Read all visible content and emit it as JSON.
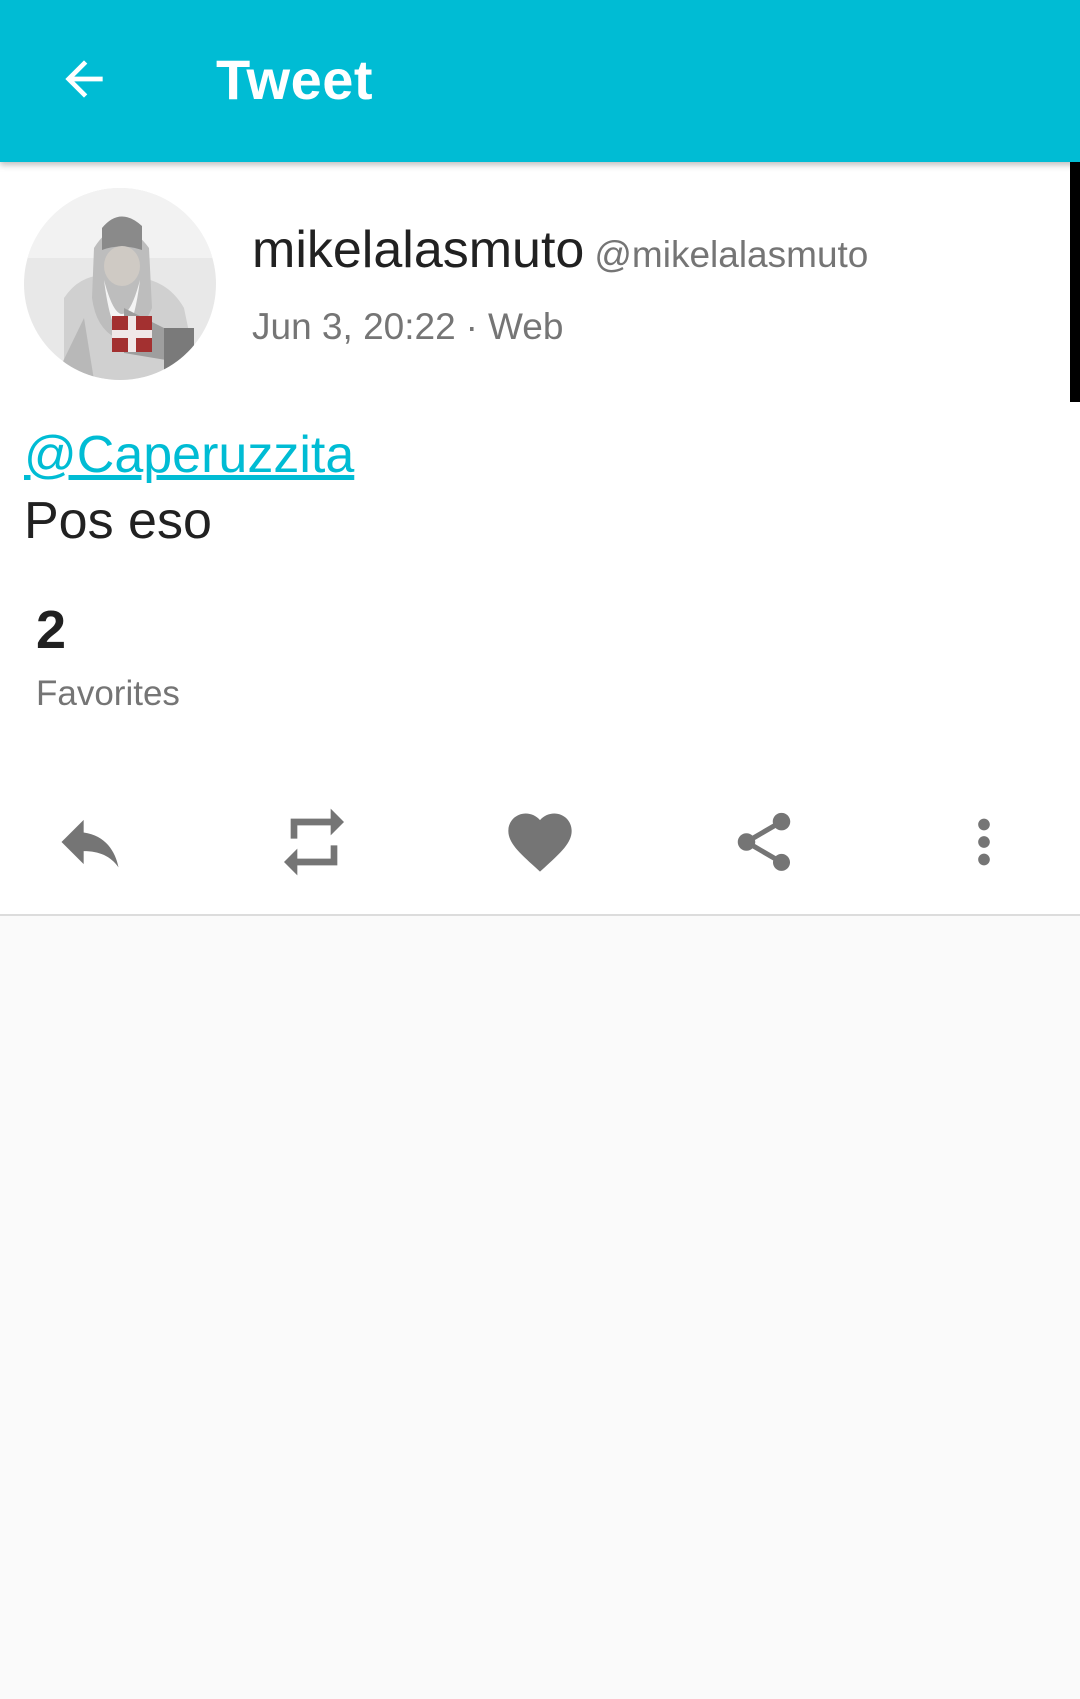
{
  "app_bar": {
    "title": "Tweet",
    "back_icon": "arrow-left-icon",
    "color": "#00bcd4"
  },
  "tweet": {
    "display_name": "mikelalasmuto",
    "handle": "@mikelalasmuto",
    "date": "Jun 3, 20:22",
    "separator": "·",
    "source": "Web",
    "mention": "@Caperuzzita",
    "text": "Pos eso",
    "link_color": "#00bcd4"
  },
  "stats": {
    "favorites_count": "2",
    "favorites_label": "Favorites"
  },
  "actions": [
    {
      "name": "reply",
      "icon": "reply-icon"
    },
    {
      "name": "retweet",
      "icon": "retweet-icon"
    },
    {
      "name": "favorite",
      "icon": "heart-icon"
    },
    {
      "name": "share",
      "icon": "share-icon"
    },
    {
      "name": "more",
      "icon": "more-vert-icon"
    }
  ]
}
